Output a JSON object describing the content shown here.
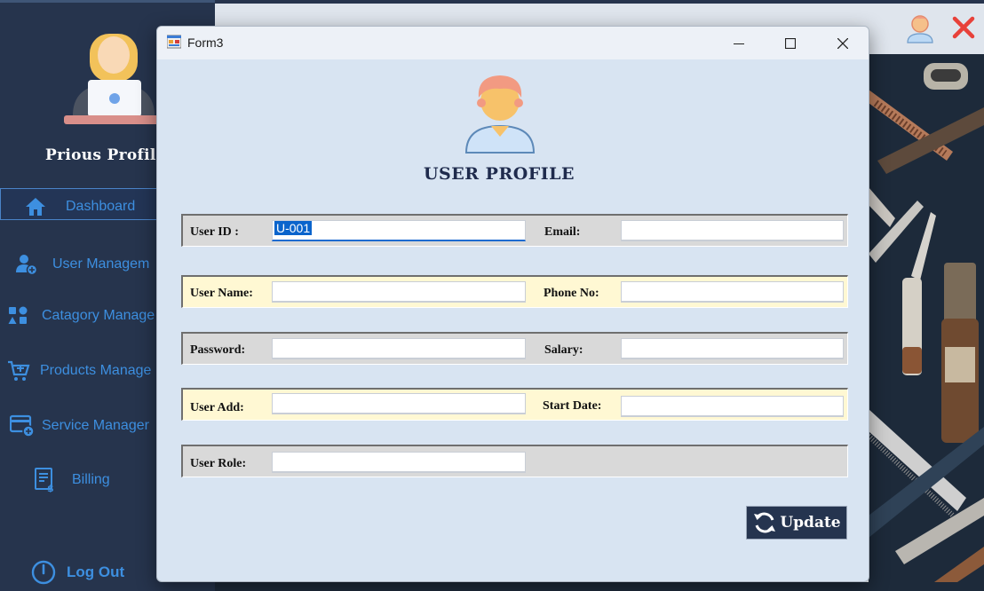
{
  "sidebar": {
    "profile_name": "Prious  Profil",
    "items": [
      {
        "label": "Dashboard",
        "icon": "home-icon"
      },
      {
        "label": "User Managem",
        "icon": "user-add-icon"
      },
      {
        "label": "Catagory Manage",
        "icon": "category-icon"
      },
      {
        "label": "Products Manage",
        "icon": "cart-icon"
      },
      {
        "label": "Service Manager",
        "icon": "service-card-icon"
      },
      {
        "label": "Billing",
        "icon": "billing-icon"
      }
    ],
    "logout_label": "Log Out"
  },
  "form": {
    "title": "Form3",
    "heading": "USER PROFILE",
    "fields": {
      "user_id": {
        "label": "User ID :",
        "value": "U-001"
      },
      "email": {
        "label": "Email:",
        "value": ""
      },
      "user_name": {
        "label": "User Name:",
        "value": ""
      },
      "phone": {
        "label": "Phone No:",
        "value": ""
      },
      "password": {
        "label": "Password:",
        "value": ""
      },
      "salary": {
        "label": "Salary:",
        "value": ""
      },
      "address": {
        "label": "User Add:",
        "value": ""
      },
      "start_date": {
        "label": "Start Date:",
        "value": ""
      },
      "role": {
        "label": "User Role:",
        "value": ""
      }
    },
    "update_label": "Update"
  },
  "colors": {
    "sidebar_bg": "#26344d",
    "nav_text": "#3d8fe0",
    "form_bg": "#d8e4f2",
    "row_grey": "#d9d9d9",
    "row_cream": "#fff8d3",
    "button_bg": "#25344f",
    "selection": "#0a64cc",
    "close_x": "#e8413a"
  }
}
